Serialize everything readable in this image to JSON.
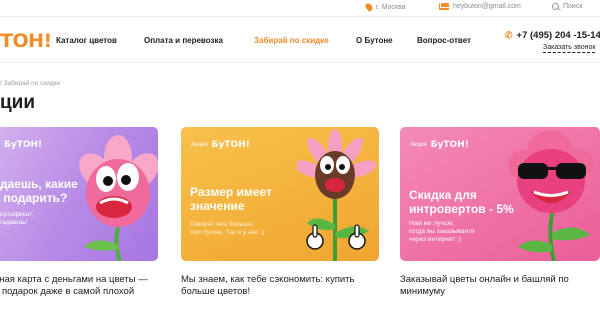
{
  "topbar": {
    "city": "г. Москва",
    "email": "heybuton@gmail.com",
    "search_label": "Поиск"
  },
  "header": {
    "logo_text": "ТОН!",
    "nav": [
      {
        "label": "Каталог цветов"
      },
      {
        "label": "Оплата и перевозка"
      },
      {
        "label": "Забирай по скидке"
      },
      {
        "label": "О Бутоне"
      },
      {
        "label": "Вопрос-ответ"
      }
    ],
    "phone": "+7 (495) 204 -15-14",
    "callback": "Заказать звонок"
  },
  "breadcrumb": "/ Забирай по скидке",
  "page_title": "ции",
  "cards": [
    {
      "promo_label": "",
      "promo_logo": "БуТОН!",
      "title": "даешь, какие\n подарить?",
      "text": "ертификат,\nгадаешь!",
      "caption": "нная карта с деньгами на цветы —\nй подарок даже в самой плохой"
    },
    {
      "promo_label": "Акция",
      "promo_logo": "БуТОН!",
      "title": "Размер имеет\nзначение",
      "text": "Говорят чем больше,\nтем лучше. Так и у нас ;)",
      "caption": "Мы знаем, как тебе сэкономить: купить\nбольше цветов!"
    },
    {
      "promo_label": "Акция",
      "promo_logo": "БуТОН!",
      "title": "Скидка для\nинтровертов - 5%",
      "text": "Нам же лучше,\nкогда вы заказываете\nчерез интернет :)",
      "caption": "Заказывай цветы онлайн и башляй по\nминимуму"
    }
  ],
  "colors": {
    "accent": "#f28c28",
    "card_purple": "#b78ae6",
    "card_yellow": "#f4b43c",
    "card_pink": "#ef76a8"
  },
  "icons": [
    "location-pin-icon",
    "mail-icon",
    "search-icon",
    "phone-icon"
  ]
}
